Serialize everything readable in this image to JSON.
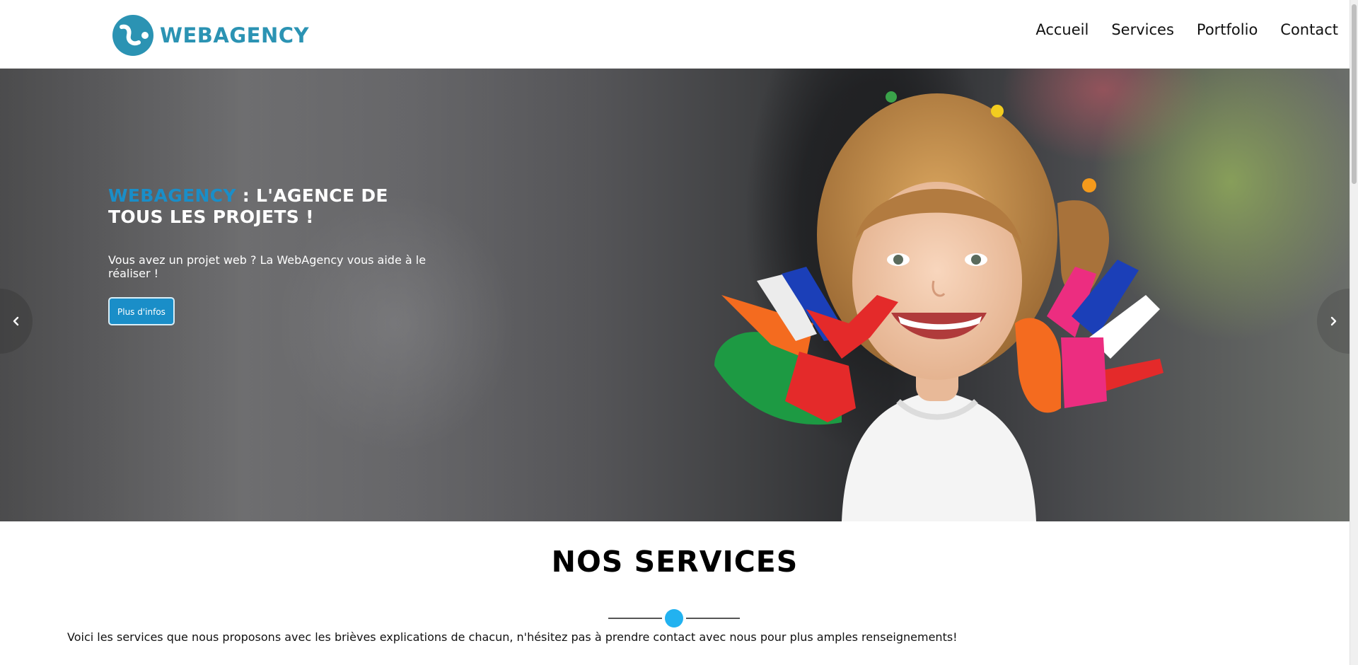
{
  "header": {
    "logo_text": "WEBAGENCY",
    "nav": [
      "Accueil",
      "Services",
      "Portfolio",
      "Contact"
    ]
  },
  "hero": {
    "title_brand": "WEBAGENCY",
    "title_rest": " : L'AGENCE DE TOUS LES PROJETS !",
    "text": "Vous avez un projet web ? La WebAgency vous aide à le réaliser !",
    "button": "Plus d'infos"
  },
  "services": {
    "title": "NOS SERVICES",
    "description": "Voici les services que nous proposons avec les brièves explications de chacun, n'hésitez pas à prendre contact avec nous pour plus amples renseignements!"
  },
  "colors": {
    "brand": "#2b93b3",
    "accent": "#1a8ec8",
    "dot": "#22b2f0"
  },
  "icons": {
    "prev": "chevron-left-icon",
    "next": "chevron-right-icon"
  }
}
